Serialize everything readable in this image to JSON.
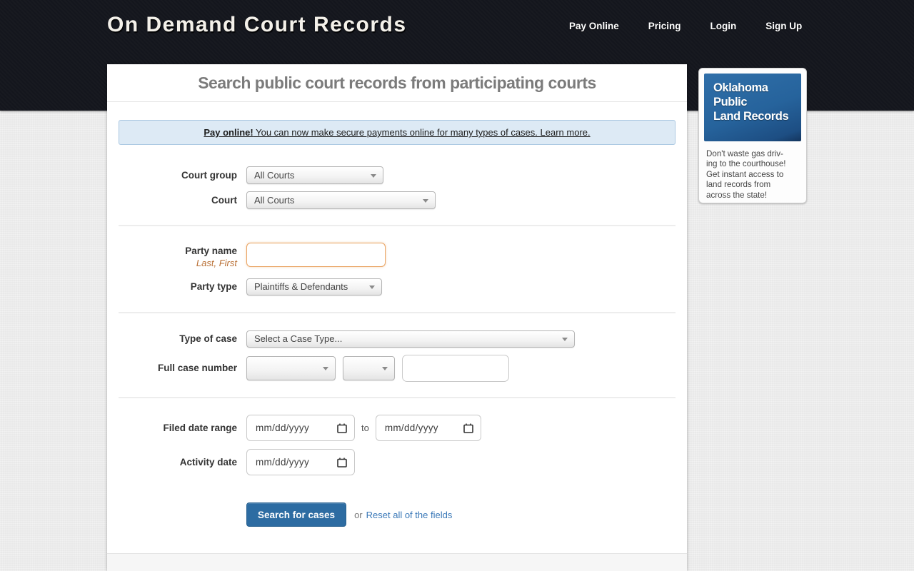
{
  "header": {
    "logo": "On Demand Court Records",
    "nav": [
      {
        "label": "Pay Online"
      },
      {
        "label": "Pricing"
      },
      {
        "label": "Login"
      },
      {
        "label": "Sign Up"
      }
    ]
  },
  "main": {
    "title": "Search public court records from participating courts",
    "banner": {
      "bold": "Pay online!",
      "text": " You can now make secure payments online for many types of cases. ",
      "link": "Learn more."
    },
    "form": {
      "court_group": {
        "label": "Court group",
        "value": "All Courts"
      },
      "court": {
        "label": "Court",
        "value": "All Courts"
      },
      "party_name": {
        "label": "Party name",
        "hint": "Last, First",
        "value": ""
      },
      "party_type": {
        "label": "Party type",
        "value": "Plaintiffs & Defendants"
      },
      "case_type": {
        "label": "Type of case",
        "value": "Select a Case Type..."
      },
      "case_number": {
        "label": "Full case number"
      },
      "filed_date": {
        "label": "Filed date range",
        "placeholder_from": "mm/dd/yyyy",
        "separator": "to",
        "placeholder_to": "mm/dd/yyyy"
      },
      "activity_date": {
        "label": "Activity date",
        "placeholder": "mm/dd/yyyy"
      },
      "submit_label": "Search for cases",
      "or_text": "or",
      "reset_label": "Reset all of the fields"
    }
  },
  "sidebar": {
    "ad": {
      "title_lines": [
        "Oklahoma",
        "Public",
        "Land Records"
      ],
      "desc_lines": [
        "Don't waste gas driv-",
        "ing to the courthouse!",
        "Get instant access to",
        "land records from",
        "across the state!"
      ]
    }
  },
  "colors": {
    "header_bg": "#14161d",
    "page_bg": "#e9e9e9",
    "button_blue": "#2d6ca2",
    "link_blue": "#3b79b8",
    "banner_bg": "#ddeaf5",
    "banner_border": "#abc8e2",
    "hint_orange": "#b96f34",
    "focus_orange": "#e9a463",
    "ad_blue": "#26639c"
  }
}
